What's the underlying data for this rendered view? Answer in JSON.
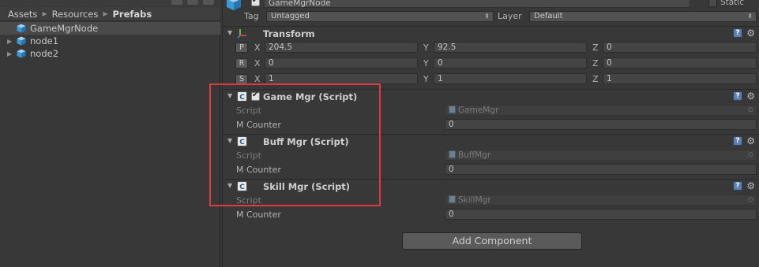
{
  "project": {
    "breadcrumb": [
      "Assets",
      "Resources",
      "Prefabs"
    ],
    "items": [
      {
        "label": "GameMgrNode",
        "selected": true,
        "expandable": false
      },
      {
        "label": "node1",
        "selected": false,
        "expandable": true
      },
      {
        "label": "node2",
        "selected": false,
        "expandable": true
      }
    ]
  },
  "inspector": {
    "object_name": "GameMgrNode",
    "static_label": "Static",
    "tag_label": "Tag",
    "tag_value": "Untagged",
    "layer_label": "Layer",
    "layer_value": "Default",
    "transform": {
      "title": "Transform",
      "rows": [
        {
          "button": "P",
          "x": "204.5",
          "y": "92.5",
          "z": "0"
        },
        {
          "button": "R",
          "x": "0",
          "y": "0",
          "z": "0"
        },
        {
          "button": "S",
          "x": "1",
          "y": "1",
          "z": "1"
        }
      ],
      "axis_x": "X",
      "axis_y": "Y",
      "axis_z": "Z"
    },
    "components": [
      {
        "title": "Game Mgr (Script)",
        "enabled_checkbox": true,
        "script_label": "Script",
        "script_value": "GameMgr",
        "prop_label": "M Counter",
        "prop_value": "0"
      },
      {
        "title": "Buff Mgr (Script)",
        "enabled_checkbox": false,
        "script_label": "Script",
        "script_value": "BuffMgr",
        "prop_label": "M Counter",
        "prop_value": "0"
      },
      {
        "title": "Skill Mgr (Script)",
        "enabled_checkbox": false,
        "script_label": "Script",
        "script_value": "SkillMgr",
        "prop_label": "M Counter",
        "prop_value": "0"
      }
    ],
    "add_component_label": "Add Component"
  },
  "colors": {
    "highlight": "#e03b3b",
    "background": "#383838"
  }
}
